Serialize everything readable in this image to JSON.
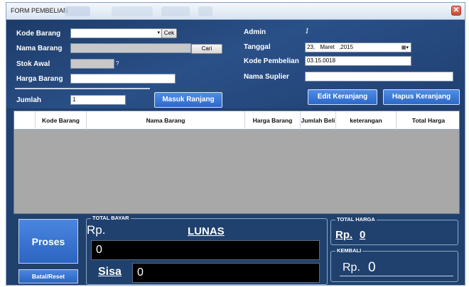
{
  "window": {
    "title": "FORM PEMBELIAN",
    "close_glyph": "✕"
  },
  "form": {
    "kode_barang": {
      "label": "Kode Barang",
      "value": "",
      "cek_label": "Cek"
    },
    "nama_barang": {
      "label": "Nama Barang",
      "value": "",
      "cari_label": "Cari"
    },
    "stok_awal": {
      "label": "Stok Awal",
      "value": "",
      "hint": "?"
    },
    "harga_barang": {
      "label": "Harga Barang",
      "value": ""
    },
    "jumlah": {
      "label": "Jumlah",
      "value": "1"
    },
    "masuk_ranjang_label": "Masuk Ranjang",
    "admin": {
      "label": "Admin",
      "value": "1"
    },
    "tanggal": {
      "label": "Tanggal",
      "day": "23,",
      "month": "Maret",
      "year": ",2015"
    },
    "kode_pembelian": {
      "label": "Kode Pembelian",
      "value": "03.15.0018"
    },
    "nama_suplier": {
      "label": "Nama Suplier",
      "value": ""
    },
    "edit_keranjang_label": "Edit Keranjang",
    "hapus_keranjang_label": "Hapus Keranjang"
  },
  "table": {
    "columns": [
      {
        "label": ""
      },
      {
        "label": "Kode Barang"
      },
      {
        "label": "Nama Barang"
      },
      {
        "label": "Harga Barang"
      },
      {
        "label": "Jumlah Beli"
      },
      {
        "label": "keterangan"
      },
      {
        "label": "Total Harga"
      }
    ],
    "rows": []
  },
  "footer": {
    "proses_label": "Proses",
    "reset_label": "Batal/Reset",
    "total_bayar": {
      "title": "TOTAL BAYAR",
      "currency": "Rp.",
      "status": "LUNAS",
      "value": "0"
    },
    "sisa": {
      "label": "Sisa",
      "value": "0"
    },
    "total_harga": {
      "title": "TOTAL HARGA",
      "currency": "Rp.",
      "value": "0"
    },
    "kembali": {
      "title": "KEMBALI",
      "currency": "Rp.",
      "value": "0"
    }
  },
  "icons": {
    "dropdown": "▾",
    "calendar": "calendar-icon",
    "close": "close-icon"
  },
  "colors": {
    "panel": "#20416e",
    "accent_button": "#3b78d8",
    "grid_body": "#a8a8a8"
  }
}
